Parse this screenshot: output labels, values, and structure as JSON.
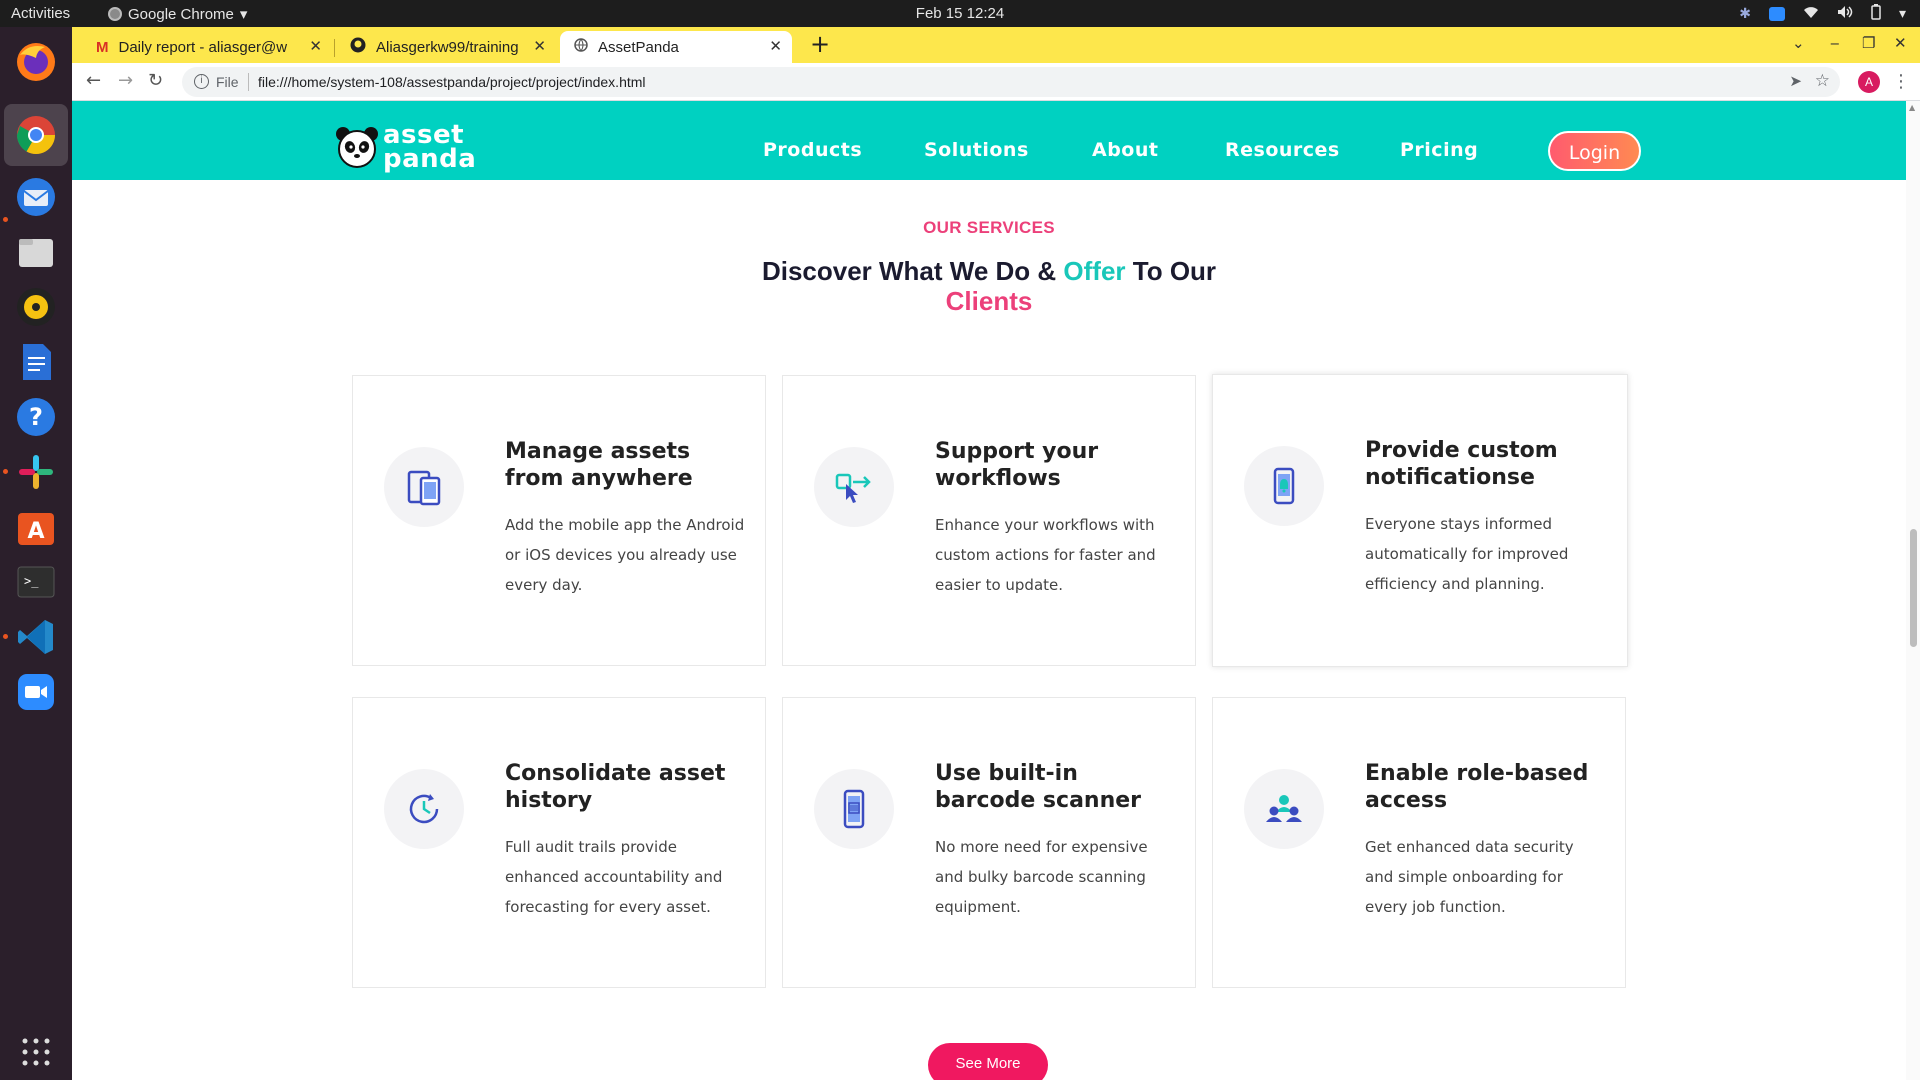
{
  "system": {
    "activities": "Activities",
    "app_name": "Google Chrome",
    "clock": "Feb 15  12:24"
  },
  "browser": {
    "tabs": [
      {
        "title": "Daily report - aliasger@w",
        "icon": "gmail-icon"
      },
      {
        "title": "Aliasgerkw99/training",
        "icon": "github-icon"
      },
      {
        "title": "AssetPanda",
        "icon": "globe-icon",
        "active": true
      }
    ],
    "url_scheme": "File",
    "url": "file:///home/system-108/assestpanda/project/project/index.html",
    "profile_initial": "A"
  },
  "site": {
    "logo": {
      "line1": "asset",
      "line2": "panda"
    },
    "nav": [
      "Products",
      "Solutions",
      "About",
      "Resources",
      "Pricing"
    ],
    "login": "Login"
  },
  "services": {
    "kicker": "OUR SERVICES",
    "title_part1": "Discover What We Do & ",
    "title_highlight1": "Offer",
    "title_part2": " To Our",
    "title_highlight2": "Clients",
    "cards": [
      {
        "title": "Manage assets from anywhere",
        "desc": "Add the mobile app the Android or iOS devices you already use every day.",
        "icon": "mobile-devices-icon"
      },
      {
        "title": "Support your workflows",
        "desc": "Enhance your workflows with custom actions for faster and easier to update.",
        "icon": "workflow-cursor-icon"
      },
      {
        "title": "Provide custom notificationse",
        "desc": "Everyone stays informed automatically for improved efficiency and planning.",
        "icon": "phone-notification-icon"
      },
      {
        "title": "Consolidate asset history",
        "desc": "Full audit trails provide enhanced accountability and forecasting for every asset.",
        "icon": "history-clock-icon"
      },
      {
        "title": "Use built-in barcode scanner",
        "desc": "No more need for expensive and bulky barcode scanning equipment.",
        "icon": "barcode-scanner-icon"
      },
      {
        "title": "Enable role-based access",
        "desc": "Get enhanced data security and simple onboarding for every job function.",
        "icon": "role-group-icon"
      }
    ],
    "see_more": "See More"
  },
  "colors": {
    "nav_bg": "#00d1c1",
    "accent_pink": "#ec407a",
    "accent_teal": "#19c7b9",
    "tabstrip": "#fde74c",
    "icon_blue": "#3b4cc0"
  }
}
